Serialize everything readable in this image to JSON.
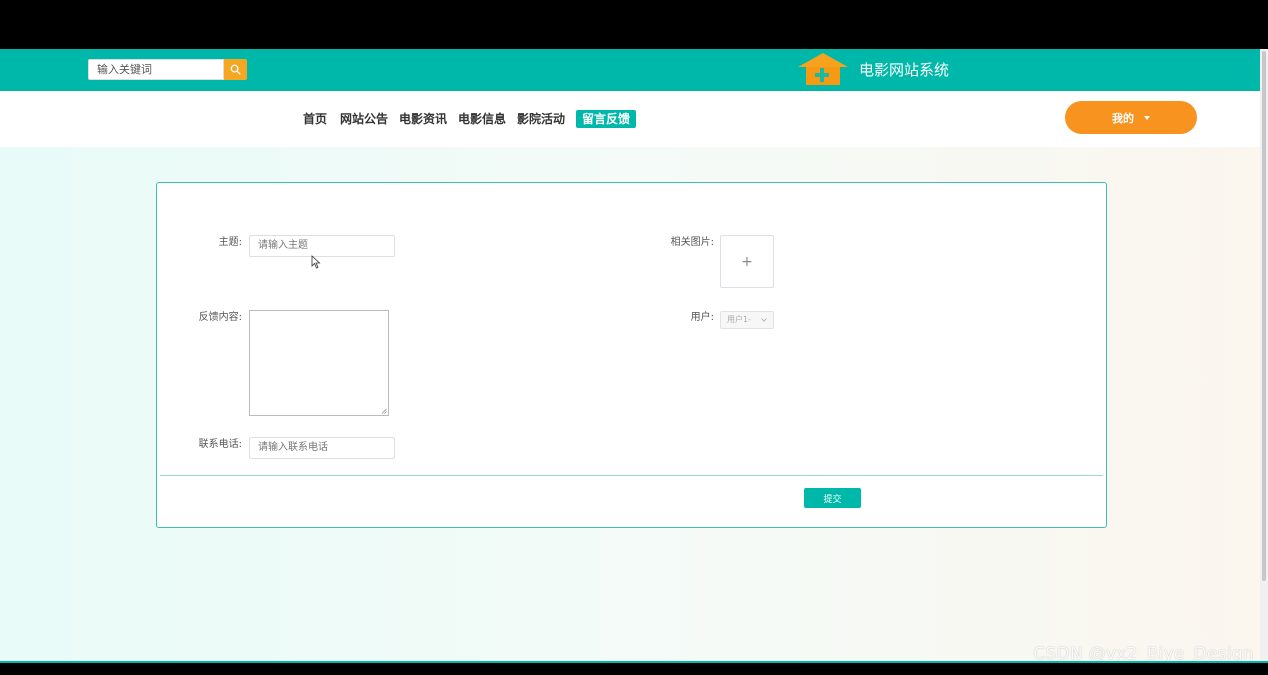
{
  "header": {
    "search_placeholder": "输入关键词",
    "site_title": "电影网站系统"
  },
  "nav": {
    "items": [
      {
        "label": "首页"
      },
      {
        "label": "网站公告"
      },
      {
        "label": "电影资讯"
      },
      {
        "label": "电影信息"
      },
      {
        "label": "影院活动"
      },
      {
        "label": "留言反馈",
        "active": true
      }
    ],
    "my_label": "我的"
  },
  "form": {
    "subject_label": "主题:",
    "subject_placeholder": "请输入主题",
    "image_label": "相关图片:",
    "upload_symbol": "+",
    "content_label": "反馈内容:",
    "user_label": "用户:",
    "user_value": "用户1-",
    "phone_label": "联系电话:",
    "phone_placeholder": "请输入联系电话",
    "submit_label": "提交"
  },
  "watermark": "CSDN @vx2_Biye_Design",
  "colors": {
    "primary": "#00b8a9",
    "accent": "#f7931e"
  }
}
